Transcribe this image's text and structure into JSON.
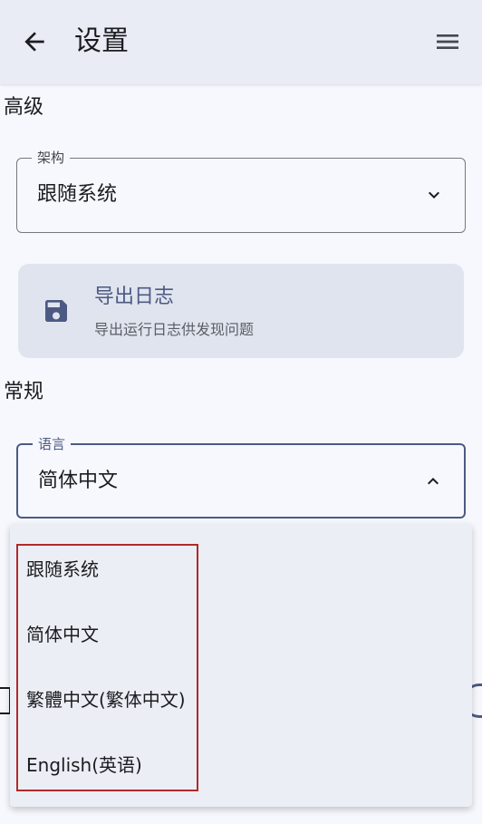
{
  "appbar": {
    "title": "设置",
    "back_icon": "arrow-back-icon",
    "menu_icon": "menu-icon"
  },
  "advanced": {
    "header": "高级",
    "arch_field": {
      "label": "架构",
      "value": "跟随系统",
      "icon": "chevron-down-icon"
    },
    "export_card": {
      "icon": "save-icon",
      "title": "导出日志",
      "subtitle": "导出运行日志供发现问题"
    }
  },
  "general": {
    "header": "常规",
    "language_field": {
      "label": "语言",
      "value": "简体中文",
      "icon": "chevron-up-icon"
    }
  },
  "language_dropdown": {
    "options": [
      "跟随系统",
      "简体中文",
      "繁體中文(繁体中文)",
      "English(英语)"
    ]
  },
  "colors": {
    "accent": "#4c5a83",
    "background": "#f7f8fd",
    "appbar": "#e9ecf4",
    "card": "#e0e4ee",
    "highlight": "#b02a2a"
  }
}
